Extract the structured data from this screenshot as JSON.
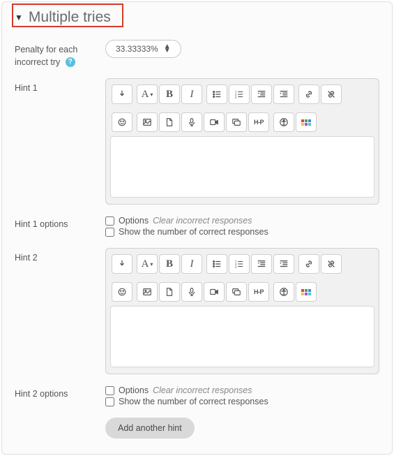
{
  "section": {
    "title": "Multiple tries"
  },
  "penalty": {
    "label": "Penalty for each incorrect try",
    "value": "33.33333%"
  },
  "hints": [
    {
      "label": "Hint 1",
      "content": ""
    },
    {
      "label": "Hint 2",
      "content": ""
    }
  ],
  "hint_options": [
    {
      "label": "Hint 1 options",
      "options_text": "Options",
      "options_secondary": "Clear incorrect responses",
      "shownum_text": "Show the number of correct responses"
    },
    {
      "label": "Hint 2 options",
      "options_text": "Options",
      "options_secondary": "Clear incorrect responses",
      "shownum_text": "Show the number of correct responses"
    }
  ],
  "add_button": "Add another hint",
  "toolbar": {
    "paragraph_letter": "A",
    "bold_letter": "B",
    "italic_letter": "I",
    "h5p": "H-P"
  }
}
